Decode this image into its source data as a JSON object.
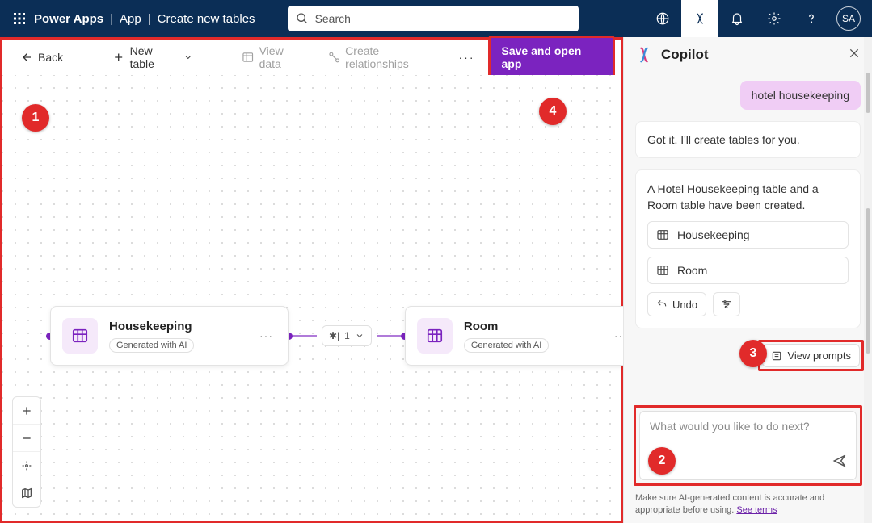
{
  "topbar": {
    "app": "Power Apps",
    "crumb1": "App",
    "crumb2": "Create new tables",
    "search_placeholder": "Search",
    "avatar": "SA"
  },
  "canvasbar": {
    "back": "Back",
    "newtable": "New table",
    "viewdata": "View data",
    "createrel": "Create relationships",
    "save": "Save and open app"
  },
  "nodes": {
    "a": {
      "name": "Housekeeping",
      "badge": "Generated with AI"
    },
    "rel": "1",
    "b": {
      "name": "Room",
      "badge": "Generated with AI"
    }
  },
  "callouts": {
    "c1": "1",
    "c2": "2",
    "c3": "3",
    "c4": "4"
  },
  "copilot": {
    "title": "Copilot",
    "user_msg": "hotel housekeeping",
    "bot_msg1": "Got it. I'll create tables for you.",
    "bot_msg2": "A Hotel Housekeeping table and a Room table have been created.",
    "tbl1": "Housekeeping",
    "tbl2": "Room",
    "undo": "Undo",
    "viewprompts": "View prompts",
    "placeholder": "What would you like to do next?",
    "disclaimer_a": "Make sure AI-generated content is accurate and appropriate before using. ",
    "disclaimer_link": "See terms"
  }
}
